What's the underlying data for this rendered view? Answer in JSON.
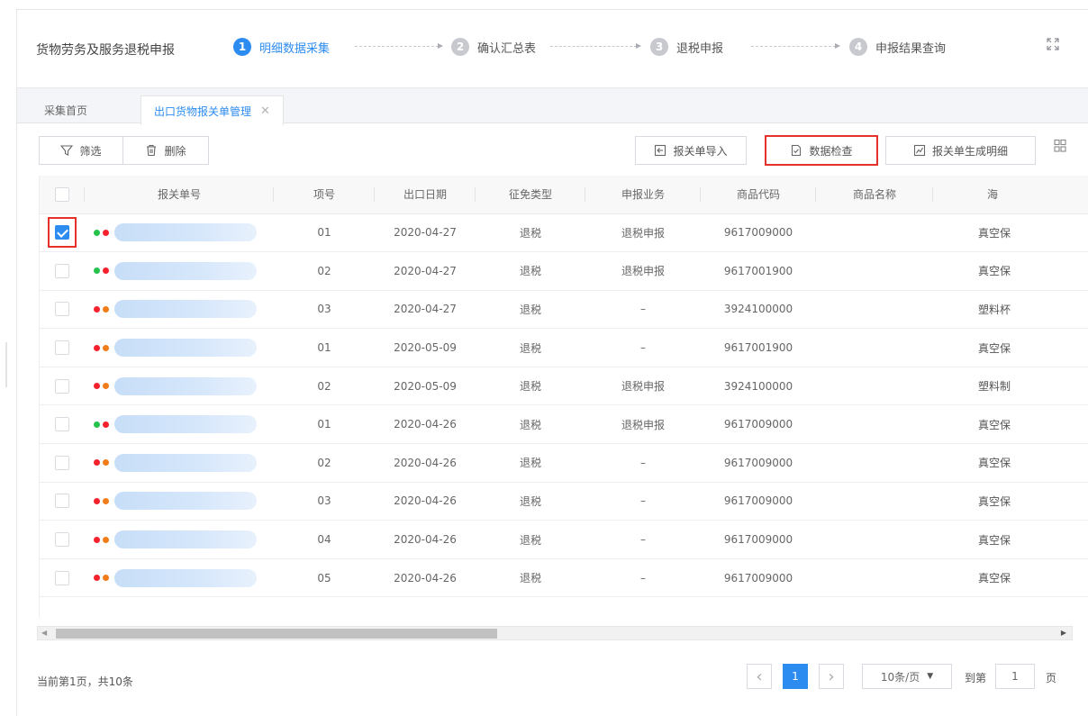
{
  "header": {
    "title": "货物劳务及服务退税申报",
    "steps": [
      {
        "num": "1",
        "label": "明细数据采集"
      },
      {
        "num": "2",
        "label": "确认汇总表"
      },
      {
        "num": "3",
        "label": "退税申报"
      },
      {
        "num": "4",
        "label": "申报结果查询"
      }
    ]
  },
  "tabs": [
    {
      "label": "采集首页"
    },
    {
      "label": "出口货物报关单管理",
      "close": "✕"
    }
  ],
  "toolbar": {
    "filter": "筛选",
    "delete": "删除",
    "import": "报关单导入",
    "check": "数据检查",
    "generate": "报关单生成明细"
  },
  "table": {
    "headers": [
      "报关单号",
      "项号",
      "出口日期",
      "征免类型",
      "申报业务",
      "商品代码",
      "商品名称",
      "海"
    ],
    "rows": [
      {
        "checked": true,
        "dots": [
          "green",
          "red"
        ],
        "item": "01",
        "date": "2020-04-27",
        "type": "退税",
        "business": "退税申报",
        "code": "9617009000",
        "name": "真空保"
      },
      {
        "checked": false,
        "dots": [
          "green",
          "red"
        ],
        "item": "02",
        "date": "2020-04-27",
        "type": "退税",
        "business": "退税申报",
        "code": "9617001900",
        "name": "真空保"
      },
      {
        "checked": false,
        "dots": [
          "red",
          "orange"
        ],
        "item": "03",
        "date": "2020-04-27",
        "type": "退税",
        "business": "–",
        "code": "3924100000",
        "name": "塑料杯"
      },
      {
        "checked": false,
        "dots": [
          "red",
          "orange"
        ],
        "item": "01",
        "date": "2020-05-09",
        "type": "退税",
        "business": "–",
        "code": "9617001900",
        "name": "真空保"
      },
      {
        "checked": false,
        "dots": [
          "red",
          "orange"
        ],
        "item": "02",
        "date": "2020-05-09",
        "type": "退税",
        "business": "退税申报",
        "code": "3924100000",
        "name": "塑料制"
      },
      {
        "checked": false,
        "dots": [
          "green",
          "red"
        ],
        "item": "01",
        "date": "2020-04-26",
        "type": "退税",
        "business": "退税申报",
        "code": "9617009000",
        "name": "真空保"
      },
      {
        "checked": false,
        "dots": [
          "red",
          "orange"
        ],
        "item": "02",
        "date": "2020-04-26",
        "type": "退税",
        "business": "–",
        "code": "9617009000",
        "name": "真空保"
      },
      {
        "checked": false,
        "dots": [
          "red",
          "orange"
        ],
        "item": "03",
        "date": "2020-04-26",
        "type": "退税",
        "business": "–",
        "code": "9617009000",
        "name": "真空保"
      },
      {
        "checked": false,
        "dots": [
          "red",
          "orange"
        ],
        "item": "04",
        "date": "2020-04-26",
        "type": "退税",
        "business": "–",
        "code": "9617009000",
        "name": "真空保"
      },
      {
        "checked": false,
        "dots": [
          "red",
          "orange"
        ],
        "item": "05",
        "date": "2020-04-26",
        "type": "退税",
        "business": "–",
        "code": "9617009000",
        "name": "真空保"
      }
    ]
  },
  "footer": {
    "info": "当前第1页，共10条",
    "prev": "‹",
    "current_page": "1",
    "next": "›",
    "page_size": "10条/页",
    "goto_label": "到第",
    "goto_value": "1",
    "goto_suffix": "页"
  },
  "colors": {
    "accent": "#2d8cf0",
    "highlight": "#e6312a",
    "dot_green": "#27c24c",
    "dot_red": "#f5222d",
    "dot_orange": "#f07d1a"
  },
  "icons": [
    "filter-icon",
    "trash-icon",
    "import-icon",
    "check-doc-icon",
    "chart-icon",
    "grid-icon",
    "fullscreen-icon"
  ]
}
